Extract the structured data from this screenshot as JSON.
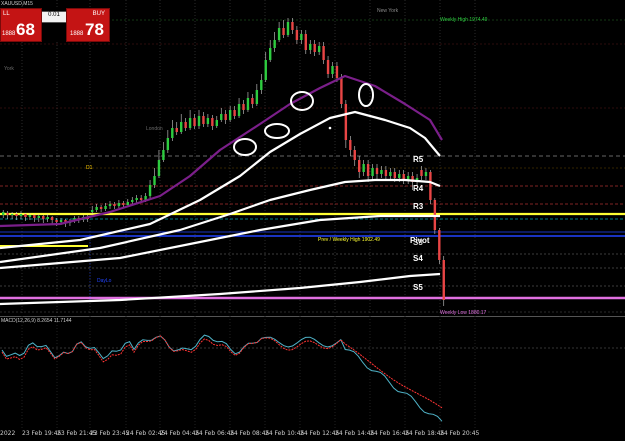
{
  "symbol": "XAUUSD,M15",
  "trade_panel": {
    "sell_label": "LL",
    "sell_price_small": "1888",
    "sell_price_big": "68",
    "lot_value": "0.01",
    "buy_label": "BUY",
    "buy_price_small": "1888",
    "buy_price_big": "78"
  },
  "session_labels": {
    "new_york": "New York",
    "york": "York",
    "london": "London"
  },
  "line_labels": {
    "weekly_high": "Weekly High 1974.49",
    "prev_weekly_high": "Prev / Weekly High 1902.49",
    "weekly_low": "Weekly Low 1880.17",
    "day_lo": "DayLo",
    "d1": "D1"
  },
  "levels": {
    "r5": "R5",
    "r4": "R4",
    "r3": "R3",
    "pivot": "Pivot",
    "s3": "S3",
    "s4": "S4",
    "s5": "S5"
  },
  "indicator_label": "MACD(12,26,9) 8.2654 11.7144",
  "time_axis": [
    "2022",
    "23 Feb 19:45",
    "23 Feb 21:45",
    "23 Feb 23:45",
    "24 Feb 02:45",
    "24 Feb 04:45",
    "24 Feb 06:45",
    "24 Feb 08:45",
    "24 Feb 10:45",
    "24 Feb 12:45",
    "24 Feb 14:45",
    "24 Feb 16:45",
    "24 Feb 18:45",
    "24 Feb 20:45"
  ],
  "colors": {
    "background": "#000000",
    "bull_candle": "#2ecc40",
    "bear_candle": "#e84545",
    "ma_white": "#ffffff",
    "ma_purple": "#7b1f8a",
    "yellow_line": "#ffff33",
    "pink_line": "#e070e0",
    "blue_line": "#2244ff"
  }
}
